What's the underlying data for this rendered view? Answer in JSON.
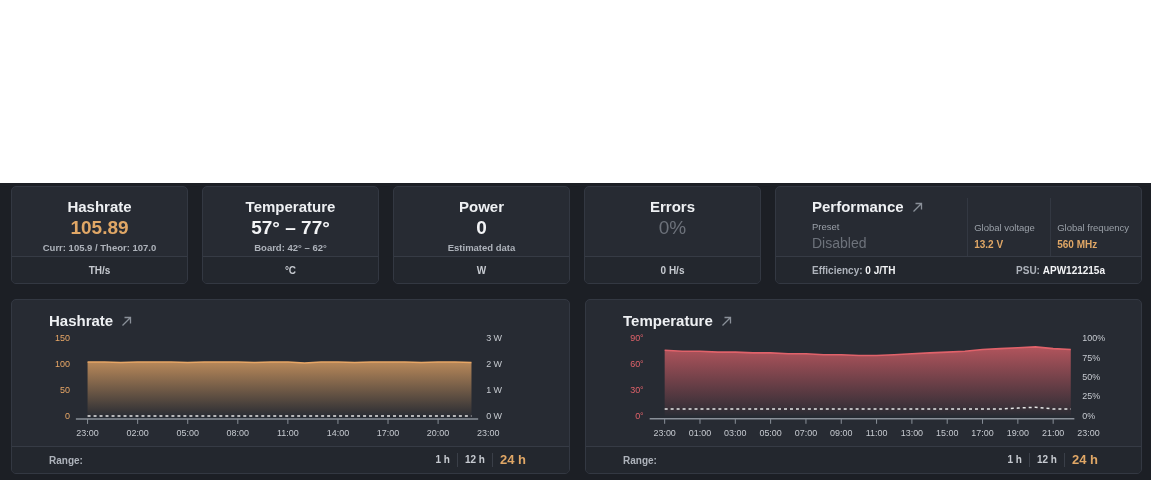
{
  "stats": [
    {
      "kind": "stat",
      "title": "Hashrate",
      "value": "105.89",
      "accent": true,
      "dimmed": false,
      "detail": "Curr: 105.9 / Theor: 107.0",
      "unit": "TH/s"
    },
    {
      "kind": "stat",
      "title": "Temperature",
      "value": "57° – 77°",
      "accent": false,
      "dimmed": false,
      "detail": "Board: 42° – 62°",
      "unit": "°C"
    },
    {
      "kind": "stat",
      "title": "Power",
      "value": "0",
      "accent": false,
      "dimmed": false,
      "detail": "Estimated data",
      "unit": "W"
    },
    {
      "kind": "stat",
      "title": "Errors",
      "value": "0%",
      "accent": false,
      "dimmed": true,
      "unit": "0 H/s"
    },
    {
      "kind": "performance",
      "title": "Performance",
      "preset_label": "Preset",
      "preset_value": "Disabled",
      "preset_disabled": true,
      "params": [
        {
          "label": "Global voltage",
          "value": "13.2 V"
        },
        {
          "label": "Global frequency",
          "value": "560 MHz"
        }
      ],
      "efficiency": "Efficiency: **0 J/TH**",
      "psu": "PSU: **APW121215a**"
    }
  ],
  "charts": [
    {
      "title": "Hashrate",
      "range_label": "Range:",
      "ranges": [
        {
          "label": "1 h",
          "selected": false
        },
        {
          "label": "12 h",
          "selected": false
        },
        {
          "label": "24 h",
          "selected": true
        }
      ],
      "right_axis_labels": [
        "3 W",
        "2 W",
        "1 W",
        "0 W"
      ],
      "chart_data": {
        "type": "area",
        "ylim": [
          0,
          150
        ],
        "yticks": [
          0,
          50,
          100,
          150
        ],
        "categories": [
          "23:00",
          null,
          null,
          "02:00",
          null,
          null,
          "05:00",
          null,
          null,
          "08:00",
          null,
          null,
          "11:00",
          null,
          null,
          "14:00",
          null,
          null,
          "17:00",
          null,
          null,
          "20:00",
          null,
          null,
          "23:00"
        ],
        "series": [
          {
            "type": "area",
            "color": "#e8a766",
            "values": [
              104,
              104,
              103,
              104,
              104,
              104,
              103,
              104,
              104,
              104,
              103,
              104,
              104,
              102,
              104,
              104,
              103,
              104,
              104,
              104,
              103,
              104,
              104,
              103,
              null
            ]
          },
          {
            "type": "line",
            "line_style": "dashed",
            "color": "#e6e6e6",
            "values": [
              0,
              0,
              0,
              0,
              0,
              0,
              0,
              0,
              0,
              0,
              0,
              0,
              0,
              0,
              0,
              0,
              0,
              0,
              0,
              0,
              0,
              0,
              0,
              0,
              null
            ]
          }
        ]
      }
    },
    {
      "title": "Temperature",
      "range_label": "Range:",
      "ranges": [
        {
          "label": "1 h",
          "selected": false
        },
        {
          "label": "12 h",
          "selected": false
        },
        {
          "label": "24 h",
          "selected": true
        }
      ],
      "right_axis_labels": [
        "100%",
        "75%",
        "50%",
        "25%",
        "0%"
      ],
      "chart_data": {
        "type": "area",
        "ylim": [
          0,
          90
        ],
        "yticks": [
          {
            "value": 0,
            "label": "0°"
          },
          {
            "value": 30,
            "label": "30°"
          },
          {
            "value": 60,
            "label": "60°"
          },
          {
            "value": 90,
            "label": "90°"
          }
        ],
        "categories": [
          "23:00",
          null,
          "01:00",
          null,
          "03:00",
          null,
          "05:00",
          null,
          "07:00",
          null,
          "09:00",
          null,
          "11:00",
          null,
          "13:00",
          null,
          "15:00",
          null,
          "17:00",
          null,
          "19:00",
          null,
          "21:00",
          null,
          "23:00"
        ],
        "series": [
          {
            "type": "area",
            "color": "#e0626a",
            "values": [
              76,
              75,
              75,
              74,
              74,
              73,
              73,
              72,
              72,
              71,
              71,
              70,
              70,
              71,
              72,
              73,
              74,
              75,
              77,
              78,
              79,
              80,
              78,
              77,
              null
            ]
          },
          {
            "type": "line",
            "line_style": "dashed",
            "color": "#e6e6e6",
            "values": [
              8,
              8,
              8,
              8,
              8,
              8,
              8,
              8,
              8,
              8,
              8,
              8,
              8,
              8,
              8,
              8,
              8,
              8,
              8,
              8,
              9,
              10,
              8,
              8,
              null
            ]
          }
        ]
      }
    }
  ]
}
